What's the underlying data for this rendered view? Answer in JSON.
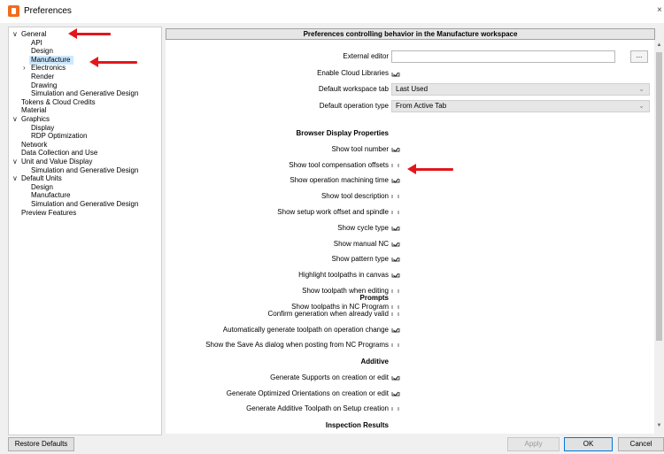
{
  "window": {
    "title": "Preferences",
    "close": "×"
  },
  "tree": [
    {
      "label": "General",
      "expanded": true
    },
    {
      "label": "API"
    },
    {
      "label": "Design"
    },
    {
      "label": "Manufacture",
      "selected": true
    },
    {
      "label": "Electronics"
    },
    {
      "label": "Render"
    },
    {
      "label": "Drawing"
    },
    {
      "label": "Simulation and Generative Design"
    },
    {
      "label": "Tokens & Cloud Credits"
    },
    {
      "label": "Material"
    },
    {
      "label": "Graphics",
      "expanded": true
    },
    {
      "label": "Display"
    },
    {
      "label": "RDP Optimization"
    },
    {
      "label": "Network"
    },
    {
      "label": "Data Collection and Use"
    },
    {
      "label": "Unit and Value Display",
      "expanded": true
    },
    {
      "label": "Simulation and Generative Design"
    },
    {
      "label": "Default Units",
      "expanded": true
    },
    {
      "label": "Design"
    },
    {
      "label": "Manufacture"
    },
    {
      "label": "Simulation and Generative Design"
    },
    {
      "label": "Preview Features"
    }
  ],
  "panel": {
    "header": "Preferences controlling behavior in the Manufacture workspace",
    "external_editor_label": "External editor",
    "external_editor_value": "",
    "browse_button": "...",
    "cloud_libraries_label": "Enable Cloud Libraries",
    "cloud_libraries_checked": true,
    "default_tab_label": "Default workspace tab",
    "default_tab_value": "Last Used",
    "default_op_label": "Default operation type",
    "default_op_value": "From Active Tab"
  },
  "sections": [
    {
      "title": "Browser Display Properties",
      "items": [
        {
          "label": "Show tool number",
          "checked": true
        },
        {
          "label": "Show tool compensation offsets",
          "checked": false
        },
        {
          "label": "Show operation machining time",
          "checked": true
        },
        {
          "label": "Show tool description",
          "checked": false
        },
        {
          "label": "Show setup work offset and spindle",
          "checked": false
        },
        {
          "label": "Show cycle type",
          "checked": true
        },
        {
          "label": "Show manual NC",
          "checked": true
        },
        {
          "label": "Show pattern type",
          "checked": true
        },
        {
          "label": "Highlight toolpaths in canvas",
          "checked": true
        },
        {
          "label": "Show toolpath when editing",
          "checked": false
        },
        {
          "label": "Show toolpaths in NC Program",
          "checked": false
        }
      ]
    },
    {
      "title": "Prompts",
      "items": [
        {
          "label": "Confirm generation when already valid",
          "checked": false
        },
        {
          "label": "Automatically generate toolpath on operation change",
          "checked": true
        },
        {
          "label": "Show the Save As dialog when posting from NC Programs",
          "checked": false
        }
      ]
    },
    {
      "title": "Additive",
      "items": [
        {
          "label": "Generate Supports on creation or edit",
          "checked": true
        },
        {
          "label": "Generate Optimized Orientations on creation or edit",
          "checked": true
        },
        {
          "label": "Generate Additive Toolpath on Setup creation",
          "checked": false
        }
      ]
    },
    {
      "title": "Inspection Results",
      "items": []
    }
  ],
  "footer": {
    "restore": "Restore Defaults",
    "apply": "Apply",
    "ok": "OK",
    "cancel": "Cancel"
  },
  "colors": {
    "annotation_arrow": "#e3161b",
    "selection": "#cce8ff",
    "accent": "#0078d7"
  }
}
